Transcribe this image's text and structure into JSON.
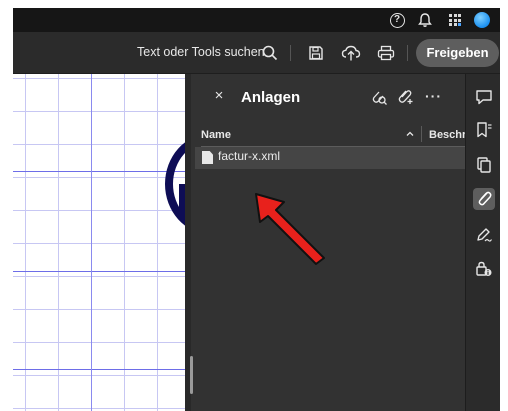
{
  "system_bar": {
    "icons": [
      "help-icon",
      "bell-icon",
      "apps-grid-icon",
      "account-avatar-icon"
    ],
    "help_glyph": "?"
  },
  "toolbar": {
    "search_label": "Text oder Tools suchen",
    "icons": [
      "search-icon",
      "save-icon",
      "upload-cloud-icon",
      "print-icon"
    ],
    "share_label": "Freigeben"
  },
  "panel": {
    "close_glyph": "×",
    "title": "Anlagen",
    "header_icons": [
      "attachment-search-icon",
      "add-attachment-icon"
    ],
    "more_glyph": "···",
    "columns": [
      {
        "label": "Name",
        "sort": "ascending"
      },
      {
        "label": "Beschreibung"
      }
    ],
    "files": [
      {
        "name": "factur-x.xml",
        "icon": "file-icon",
        "selected": true
      }
    ]
  },
  "annotation": {
    "type": "arrow",
    "color": "#e8211c"
  },
  "right_rail": {
    "items": [
      {
        "name": "comment-icon",
        "active": false
      },
      {
        "name": "bookmark-icon",
        "active": false
      },
      {
        "name": "pages-icon",
        "active": false
      },
      {
        "name": "attachment-icon",
        "active": true
      },
      {
        "name": "fill-sign-icon",
        "active": false
      },
      {
        "name": "protect-info-icon",
        "active": false
      }
    ]
  },
  "colors": {
    "panel_bg": "#323232",
    "toolbar_bg": "#2b2b2b",
    "system_bg": "#161616",
    "accent_button": "#5e5e5e",
    "grid_lines": "#8a8aef",
    "logo_navy": "#0e0d55",
    "arrow_red": "#e8211c"
  }
}
